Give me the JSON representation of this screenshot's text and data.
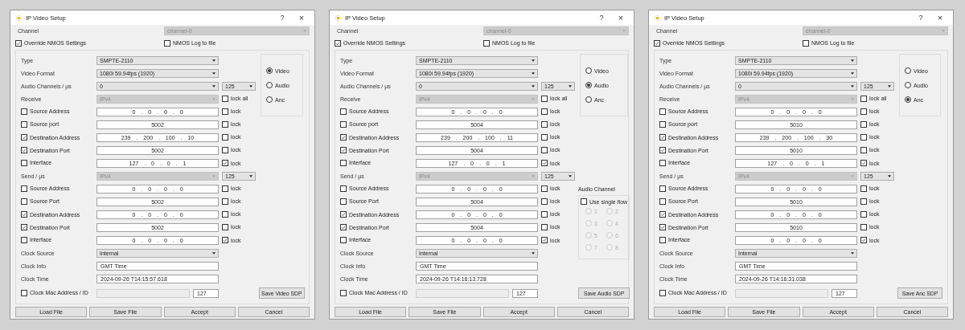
{
  "windows": [
    {
      "title": "IP Video Setup",
      "help": "?",
      "close": "×",
      "channel": {
        "label": "Channel",
        "value": "channel-0",
        "disabled": true
      },
      "override": {
        "label": "Override NMOS Settings",
        "checked": true
      },
      "nmos_log": {
        "label": "NMOS Log to file",
        "checked": false
      },
      "type": {
        "label": "Type",
        "value": "SMPTE-2110"
      },
      "video_format": {
        "label": "Video Format",
        "value": "1080i 59.94fps (1920)"
      },
      "audio_channels": {
        "label": "Audio Channels / µs",
        "value": "0",
        "us": "125"
      },
      "receive": {
        "label": "Receive",
        "value": "IPv4",
        "disabled": true,
        "lock_all": {
          "label": "lock all",
          "checked": false
        }
      },
      "receive_rows": [
        {
          "kind": "ip",
          "label": "Source Address",
          "checked": false,
          "value": "0 . 0 . 0 . 0",
          "lock": {
            "label": "lock",
            "checked": false
          }
        },
        {
          "kind": "port",
          "label": "Source port",
          "checked": false,
          "value": "5002",
          "lock": {
            "label": "lock",
            "checked": false
          }
        },
        {
          "kind": "ip",
          "label": "Destination Address",
          "checked": true,
          "value": "239 . 200 . 100 . 10",
          "lock": {
            "label": "lock",
            "checked": false
          }
        },
        {
          "kind": "port",
          "label": "Destination Port",
          "checked": true,
          "value": "5002",
          "lock": {
            "label": "lock",
            "checked": false
          }
        },
        {
          "kind": "ip",
          "label": "Interface",
          "checked": false,
          "value": "127 . 0 . 0 . 1",
          "lock": {
            "label": "lock",
            "checked": true
          }
        }
      ],
      "send": {
        "label": "Send / µs",
        "value": "IPv4",
        "disabled": true,
        "us": "125"
      },
      "send_rows": [
        {
          "kind": "ip",
          "label": "Source Address",
          "checked": false,
          "value": "0 . 0 . 0 . 0",
          "lock": {
            "label": "lock",
            "checked": false
          }
        },
        {
          "kind": "port",
          "label": "Source Port",
          "checked": false,
          "value": "5002",
          "lock": {
            "label": "lock",
            "checked": false
          }
        },
        {
          "kind": "ip",
          "label": "Destination Address",
          "checked": true,
          "value": "0 . 0 . 0 . 0",
          "lock": {
            "label": "lock",
            "checked": false
          }
        },
        {
          "kind": "port",
          "label": "Destination Port",
          "checked": true,
          "value": "5002",
          "lock": {
            "label": "lock",
            "checked": false
          }
        },
        {
          "kind": "ip",
          "label": "Interface",
          "checked": false,
          "value": "0 . 0 . 0 . 0",
          "lock": {
            "label": "lock",
            "checked": true
          }
        }
      ],
      "clock_source": {
        "label": "Clock Source",
        "value": "Internal"
      },
      "clock_info": {
        "label": "Clock Info",
        "value": "GMT Time"
      },
      "clock_time": {
        "label": "Clock Time",
        "value": "2024-09-26 T14:15:57.618"
      },
      "clock_mac": {
        "label": "Clock Mac Address / ID",
        "checked": false,
        "field_disabled": true,
        "id": "127"
      },
      "stream_types": [
        {
          "label": "Video",
          "selected": true
        },
        {
          "label": "Audio",
          "selected": false
        },
        {
          "label": "Anc",
          "selected": false
        }
      ],
      "save_sdp": "Save Video SDP",
      "buttons": [
        "Load File",
        "Save File",
        "Accept",
        "Cancel"
      ]
    },
    {
      "title": "IP Video Setup",
      "help": "?",
      "close": "×",
      "channel": {
        "label": "Channel",
        "value": "channel-0",
        "disabled": true
      },
      "override": {
        "label": "Override NMOS Settings",
        "checked": true
      },
      "nmos_log": {
        "label": "NMOS Log to file",
        "checked": false
      },
      "type": {
        "label": "Type",
        "value": "SMPTE-2110"
      },
      "video_format": {
        "label": "Video Format",
        "value": "1080i 59.94fps (1920)"
      },
      "audio_channels": {
        "label": "Audio Channels / µs",
        "value": "0",
        "us": "125"
      },
      "receive": {
        "label": "Receive",
        "value": "IPv4",
        "disabled": true,
        "lock_all": {
          "label": "lock all",
          "checked": false
        }
      },
      "receive_rows": [
        {
          "kind": "ip",
          "label": "Source Address",
          "checked": false,
          "value": "0 . 0 . 0 . 0",
          "lock": {
            "label": "lock",
            "checked": false
          }
        },
        {
          "kind": "port",
          "label": "Source port",
          "checked": false,
          "value": "5004",
          "lock": {
            "label": "lock",
            "checked": false
          }
        },
        {
          "kind": "ip",
          "label": "Destination Address",
          "checked": true,
          "value": "239 . 200 . 100 . 11",
          "lock": {
            "label": "lock",
            "checked": false
          }
        },
        {
          "kind": "port",
          "label": "Destination Port",
          "checked": true,
          "value": "5004",
          "lock": {
            "label": "lock",
            "checked": false
          }
        },
        {
          "kind": "ip",
          "label": "Interface",
          "checked": false,
          "value": "127 . 0 . 0 . 1",
          "lock": {
            "label": "lock",
            "checked": true
          }
        }
      ],
      "send": {
        "label": "Send / µs",
        "value": "IPv4",
        "disabled": true,
        "us": "125"
      },
      "send_rows": [
        {
          "kind": "ip",
          "label": "Source Address",
          "checked": false,
          "value": "0 . 0 . 0 . 0",
          "lock": {
            "label": "lock",
            "checked": false
          }
        },
        {
          "kind": "port",
          "label": "Source Port",
          "checked": false,
          "value": "5004",
          "lock": {
            "label": "lock",
            "checked": false
          }
        },
        {
          "kind": "ip",
          "label": "Destination Address",
          "checked": true,
          "value": "0 . 0 . 0 . 0",
          "lock": {
            "label": "lock",
            "checked": false
          }
        },
        {
          "kind": "port",
          "label": "Destination Port",
          "checked": true,
          "value": "5004",
          "lock": {
            "label": "lock",
            "checked": false
          }
        },
        {
          "kind": "ip",
          "label": "Interface",
          "checked": false,
          "value": "0 . 0 . 0 . 0",
          "lock": {
            "label": "lock",
            "checked": true
          }
        }
      ],
      "clock_source": {
        "label": "Clock Source",
        "value": "Internal"
      },
      "clock_info": {
        "label": "Clock Info",
        "value": "GMT Time"
      },
      "clock_time": {
        "label": "Clock Time",
        "value": "2024-09-26 T14:16:13.728"
      },
      "clock_mac": {
        "label": "Clock Mac Address / ID",
        "checked": false,
        "field_disabled": true,
        "id": "127"
      },
      "stream_types": [
        {
          "label": "Video",
          "selected": false
        },
        {
          "label": "Audio",
          "selected": true
        },
        {
          "label": "Anc",
          "selected": false
        }
      ],
      "audio_channel": {
        "label": "Audio Channel",
        "disabled": true,
        "single_flow": {
          "label": "Use single flow",
          "checked": false
        },
        "channels": [
          {
            "label": "1",
            "selected": false
          },
          {
            "label": "2",
            "selected": false
          },
          {
            "label": "3",
            "selected": false
          },
          {
            "label": "4",
            "selected": false
          },
          {
            "label": "5",
            "selected": false
          },
          {
            "label": "6",
            "selected": false
          },
          {
            "label": "7",
            "selected": false
          },
          {
            "label": "8",
            "selected": false
          }
        ]
      },
      "save_sdp": "Save Audio SDP",
      "buttons": [
        "Load File",
        "Save File",
        "Accept",
        "Cancel"
      ]
    },
    {
      "title": "IP Video Setup",
      "help": "?",
      "close": "×",
      "channel": {
        "label": "Channel",
        "value": "channel-0",
        "disabled": true
      },
      "override": {
        "label": "Override NMOS Settings",
        "checked": true
      },
      "nmos_log": {
        "label": "NMOS Log to file",
        "checked": false
      },
      "type": {
        "label": "Type",
        "value": "SMPTE-2110"
      },
      "video_format": {
        "label": "Video Format",
        "value": "1080i 59.94fps (1920)"
      },
      "audio_channels": {
        "label": "Audio Channels / µs",
        "value": "0",
        "us": "125"
      },
      "receive": {
        "label": "Receive",
        "value": "IPv4",
        "disabled": true,
        "lock_all": {
          "label": "lock all",
          "checked": false
        }
      },
      "receive_rows": [
        {
          "kind": "ip",
          "label": "Source Address",
          "checked": false,
          "value": "0 . 0 . 0 . 0",
          "lock": {
            "label": "lock",
            "checked": false
          }
        },
        {
          "kind": "port",
          "label": "Source port",
          "checked": false,
          "value": "5010",
          "lock": {
            "label": "lock",
            "checked": false
          }
        },
        {
          "kind": "ip",
          "label": "Destination Address",
          "checked": true,
          "value": "239 . 200 . 100 . 30",
          "lock": {
            "label": "lock",
            "checked": false
          }
        },
        {
          "kind": "port",
          "label": "Destination Port",
          "checked": true,
          "value": "5010",
          "lock": {
            "label": "lock",
            "checked": false
          }
        },
        {
          "kind": "ip",
          "label": "Interface",
          "checked": false,
          "value": "127 . 0 . 0 . 1",
          "lock": {
            "label": "lock",
            "checked": true
          }
        }
      ],
      "send": {
        "label": "Send / µs",
        "value": "IPv4",
        "disabled": true,
        "us": "125"
      },
      "send_rows": [
        {
          "kind": "ip",
          "label": "Source Address",
          "checked": false,
          "value": "0 . 0 . 0 . 0",
          "lock": {
            "label": "lock",
            "checked": false
          }
        },
        {
          "kind": "port",
          "label": "Source Port",
          "checked": false,
          "value": "5010",
          "lock": {
            "label": "lock",
            "checked": false
          }
        },
        {
          "kind": "ip",
          "label": "Destination Address",
          "checked": true,
          "value": "0 . 0 . 0 . 0",
          "lock": {
            "label": "lock",
            "checked": false
          }
        },
        {
          "kind": "port",
          "label": "Destination Port",
          "checked": true,
          "value": "5010",
          "lock": {
            "label": "lock",
            "checked": false
          }
        },
        {
          "kind": "ip",
          "label": "Interface",
          "checked": false,
          "value": "0 . 0 . 0 . 0",
          "lock": {
            "label": "lock",
            "checked": true
          }
        }
      ],
      "clock_source": {
        "label": "Clock Source",
        "value": "Internal"
      },
      "clock_info": {
        "label": "Clock Info",
        "value": "GMT Time"
      },
      "clock_time": {
        "label": "Clock Time",
        "value": "2024-09-26 T14:16:31.038"
      },
      "clock_mac": {
        "label": "Clock Mac Address / ID",
        "checked": false,
        "field_disabled": true,
        "id": "127"
      },
      "stream_types": [
        {
          "label": "Video",
          "selected": false
        },
        {
          "label": "Audio",
          "selected": false
        },
        {
          "label": "Anc",
          "selected": true
        }
      ],
      "save_sdp": "Save Anc SDP",
      "buttons": [
        "Load File",
        "Save File",
        "Accept",
        "Cancel"
      ]
    }
  ]
}
